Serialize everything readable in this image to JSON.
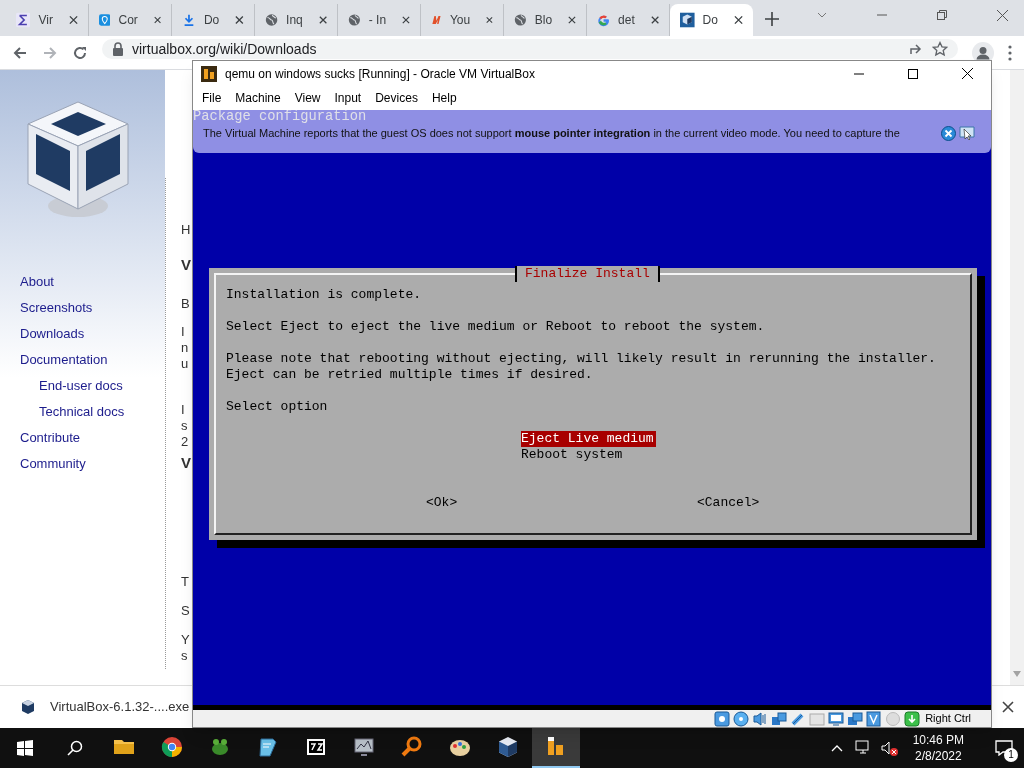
{
  "browser": {
    "tabs": [
      {
        "label": "Vir",
        "kind": "sigma",
        "selected": false
      },
      {
        "label": "Cor",
        "kind": "pin",
        "selected": false
      },
      {
        "label": "Do",
        "kind": "download",
        "selected": false
      },
      {
        "label": "Inq",
        "kind": "globe",
        "selected": false
      },
      {
        "label": "- In",
        "kind": "globe",
        "selected": false
      },
      {
        "label": "You",
        "kind": "m",
        "selected": false
      },
      {
        "label": "Blo",
        "kind": "globe",
        "selected": false
      },
      {
        "label": "det",
        "kind": "g",
        "selected": false
      },
      {
        "label": "Do",
        "kind": "vbox",
        "selected": true
      }
    ],
    "url": "virtualbox.org/wiki/Downloads"
  },
  "page": {
    "sidebar": {
      "items": [
        {
          "label": "About"
        },
        {
          "label": "Screenshots"
        },
        {
          "label": "Downloads"
        },
        {
          "label": "Documentation",
          "children": [
            {
              "label": "End-user docs"
            },
            {
              "label": "Technical docs"
            }
          ]
        },
        {
          "label": "Contribute"
        },
        {
          "label": "Community"
        }
      ]
    },
    "content_fragments": [
      {
        "text": "H",
        "kind": "text"
      },
      {
        "text": "V",
        "kind": "heading"
      },
      {
        "text": "B",
        "kind": "text"
      },
      {
        "text": "I",
        "kind": "text"
      },
      {
        "text": "n",
        "kind": "text"
      },
      {
        "text": "u",
        "kind": "text"
      },
      {
        "text": "I",
        "kind": "text"
      },
      {
        "text": "s",
        "kind": "text"
      },
      {
        "text": "2",
        "kind": "text"
      },
      {
        "text": "V",
        "kind": "heading"
      },
      {
        "text": "T",
        "kind": "text"
      },
      {
        "text": "S",
        "kind": "text"
      },
      {
        "text": "Y",
        "kind": "text"
      },
      {
        "text": "s",
        "kind": "text"
      }
    ]
  },
  "download_bar": {
    "file": "VirtualBox-6.1.32-....exe"
  },
  "vm_window": {
    "title": "qemu on windows sucks [Running] - Oracle VM VirtualBox",
    "menu": [
      "File",
      "Machine",
      "View",
      "Input",
      "Devices",
      "Help"
    ],
    "notification": "The Virtual Machine reports that the guest OS does not support **mouse pointer integration** in the current video mode. You need to capture the",
    "screen": {
      "background_title": "Package configuration",
      "dialog": {
        "title": "Finalize Install",
        "paragraphs": [
          [
            "Installation is complete."
          ],
          [
            "Select Eject to eject the live medium or Reboot to reboot the system."
          ],
          [
            "Please note that rebooting without ejecting, will likely result in rerunning the installer.",
            "Eject can be retried multiple times if desired."
          ],
          [
            "Select option"
          ]
        ],
        "options": [
          {
            "label": "Eject Live medium",
            "selected": true
          },
          {
            "label": "Reboot system",
            "selected": false
          }
        ],
        "buttons": [
          "<Ok>",
          "<Cancel>"
        ]
      }
    },
    "status_bar": {
      "host_key": "Right Ctrl"
    }
  },
  "taskbar": {
    "apps": [
      {
        "kind": "folder"
      },
      {
        "kind": "chrome"
      },
      {
        "kind": "frog"
      },
      {
        "kind": "notepad"
      },
      {
        "kind": "archive"
      },
      {
        "kind": "monitor"
      },
      {
        "kind": "magnifier"
      },
      {
        "kind": "palette"
      },
      {
        "kind": "vbox"
      },
      {
        "kind": "qemu",
        "selected": true
      }
    ],
    "time": "10:46 PM",
    "date": "2/8/2022",
    "notifications": "1"
  }
}
